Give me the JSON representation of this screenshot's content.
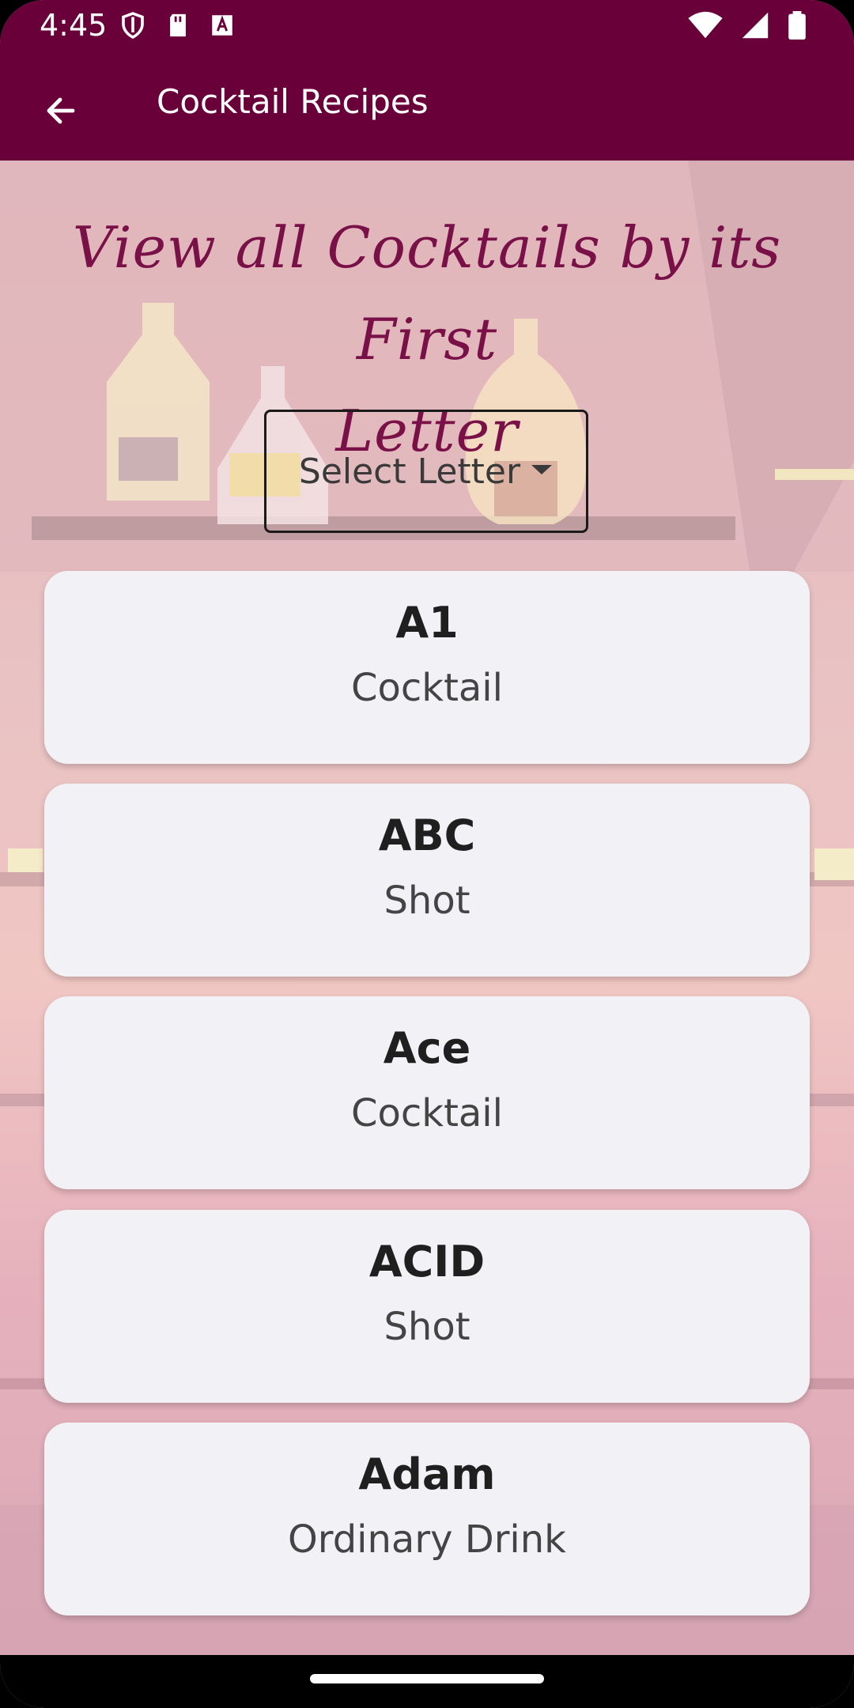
{
  "status_bar": {
    "time": "4:45",
    "left_icons": [
      "shield-icon",
      "sd-card-icon",
      "text-a-icon"
    ],
    "right_icons": [
      "wifi-icon",
      "signal-icon",
      "battery-icon"
    ]
  },
  "app_bar": {
    "title": "Cocktail Recipes",
    "back_icon": "arrow-left-icon"
  },
  "heading": {
    "line1": "View all Cocktails by its First",
    "line2": "Letter"
  },
  "select": {
    "label": "Select Letter"
  },
  "cards": [
    {
      "name": "A1",
      "category": "Cocktail"
    },
    {
      "name": "ABC",
      "category": "Shot"
    },
    {
      "name": "Ace",
      "category": "Cocktail"
    },
    {
      "name": "ACID",
      "category": "Shot"
    },
    {
      "name": "Adam",
      "category": "Ordinary Drink"
    }
  ],
  "colors": {
    "primary": "#6a003a",
    "heading": "#7a1048",
    "card_bg": "#f2f1f6"
  }
}
